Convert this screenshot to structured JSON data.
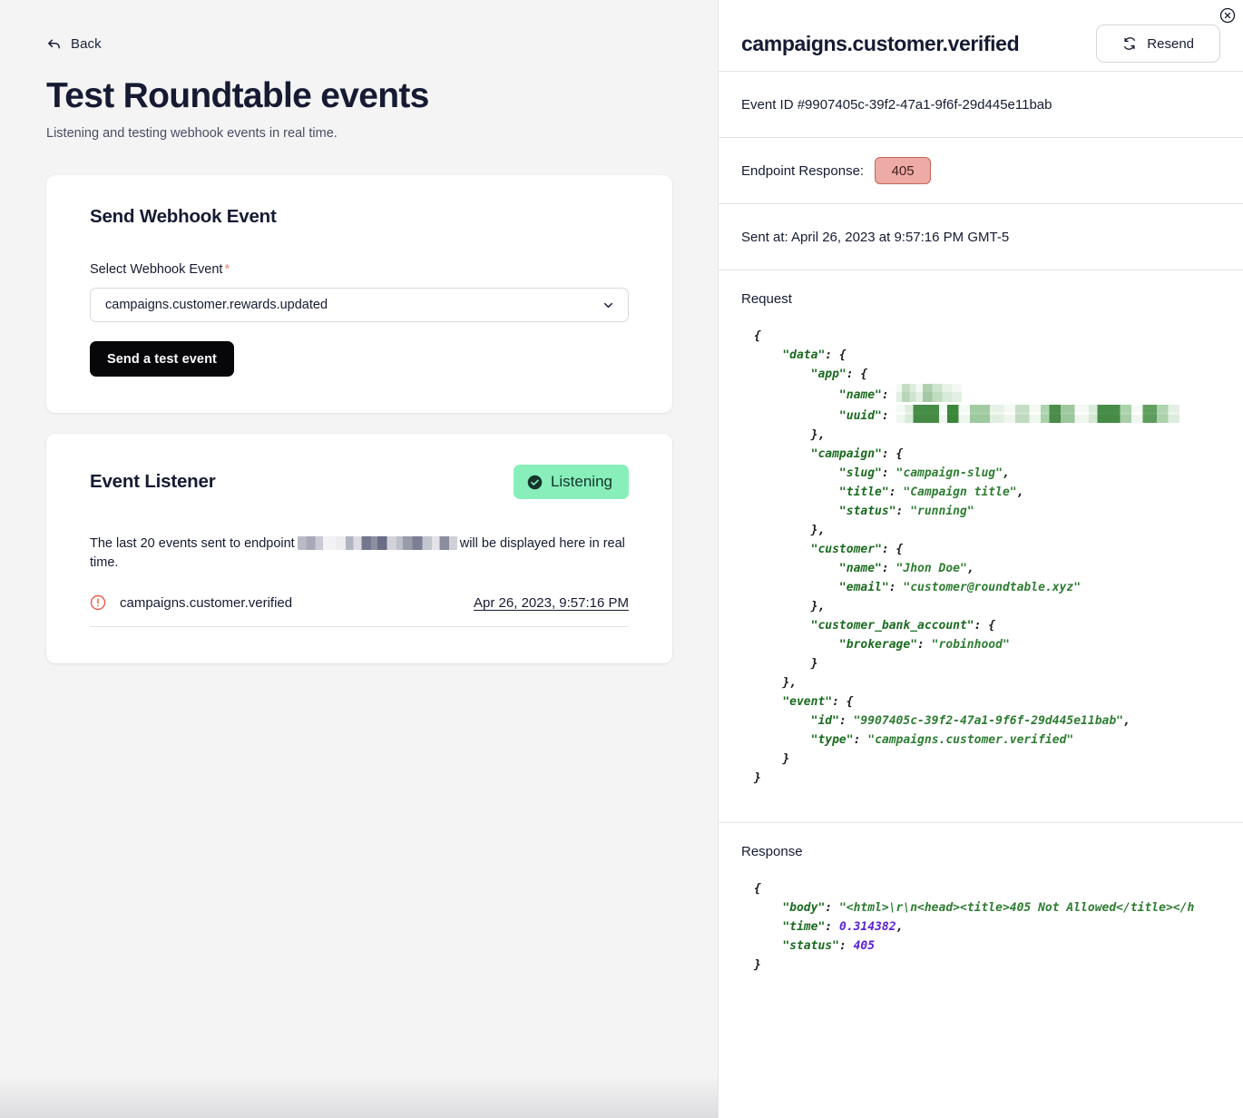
{
  "left": {
    "back_label": "Back",
    "title": "Test Roundtable events",
    "subtitle": "Listening and testing webhook events in real time.",
    "send_card": {
      "title": "Send Webhook Event",
      "field_label": "Select Webhook Event",
      "required_marker": "*",
      "selected_event": "campaigns.customer.rewards.updated",
      "submit_label": "Send a test event"
    },
    "listener_card": {
      "title": "Event Listener",
      "status_badge": "Listening",
      "description_prefix": "The last 20 events sent to endpoint",
      "description_suffix": "will be displayed here in real time.",
      "events": [
        {
          "name": "campaigns.customer.verified",
          "timestamp": "Apr 26, 2023, 9:57:16 PM",
          "status": "error"
        }
      ]
    }
  },
  "right": {
    "title": "campaigns.customer.verified",
    "resend_label": "Resend",
    "event_id_label": "Event ID #9907405c-39f2-47a1-9f6f-29d445e11bab",
    "endpoint_response_label": "Endpoint Response:",
    "endpoint_response_code": "405",
    "sent_at_label": "Sent at: April 26, 2023 at 9:57:16 PM GMT-5",
    "request_label": "Request",
    "response_label": "Response",
    "request_body": {
      "data": {
        "app": {
          "name": "[redacted]",
          "uuid": "[redacted]"
        },
        "campaign": {
          "slug": "campaign-slug",
          "title": "Campaign title",
          "status": "running"
        },
        "customer": {
          "name": "Jhon Doe",
          "email": "customer@roundtable.xyz"
        },
        "customer_bank_account": {
          "brokerage": "robinhood"
        }
      },
      "event": {
        "id": "9907405c-39f2-47a1-9f6f-29d445e11bab",
        "type": "campaigns.customer.verified"
      }
    },
    "response_body": {
      "body": "<html>\\r\\n<head><title>405 Not Allowed</title></...",
      "time": "0.314382",
      "status": "405"
    }
  },
  "colors": {
    "page_bg": "#f4f4f5",
    "card_bg": "#ffffff",
    "text": "#161b33",
    "accent_dark": "#07070a",
    "listening_green": "#88efbb",
    "error_red": "#ec5b4a",
    "status_badge_bg": "#eeaaa4",
    "status_badge_border": "#c4665f",
    "json_string": "#2e7d32",
    "json_number": "#5b21d6"
  }
}
